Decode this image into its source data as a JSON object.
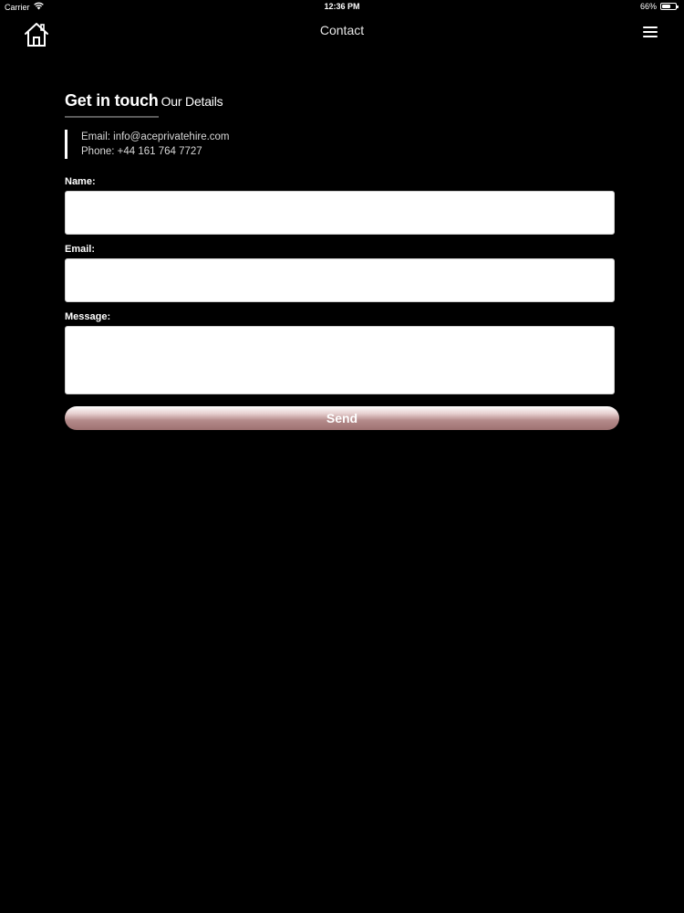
{
  "status_bar": {
    "carrier": "Carrier",
    "time": "12:36 PM",
    "battery_percent": "66%",
    "battery_level": 0.66
  },
  "nav": {
    "title": "Contact",
    "home_icon": "home-icon",
    "menu_icon": "hamburger-menu-icon"
  },
  "heading": {
    "main": "Get in touch",
    "sub": "Our Details"
  },
  "details": {
    "email": "Email: info@aceprivatehire.com",
    "phone": "Phone: +44 161 764 7727"
  },
  "form": {
    "name_label": "Name:",
    "name_value": "",
    "email_label": "Email:",
    "email_value": "",
    "message_label": "Message:",
    "message_value": "",
    "send_label": "Send"
  },
  "colors": {
    "background": "#000000",
    "button_gradient_top": "#ffffff",
    "button_gradient_bottom": "#9e7171"
  }
}
